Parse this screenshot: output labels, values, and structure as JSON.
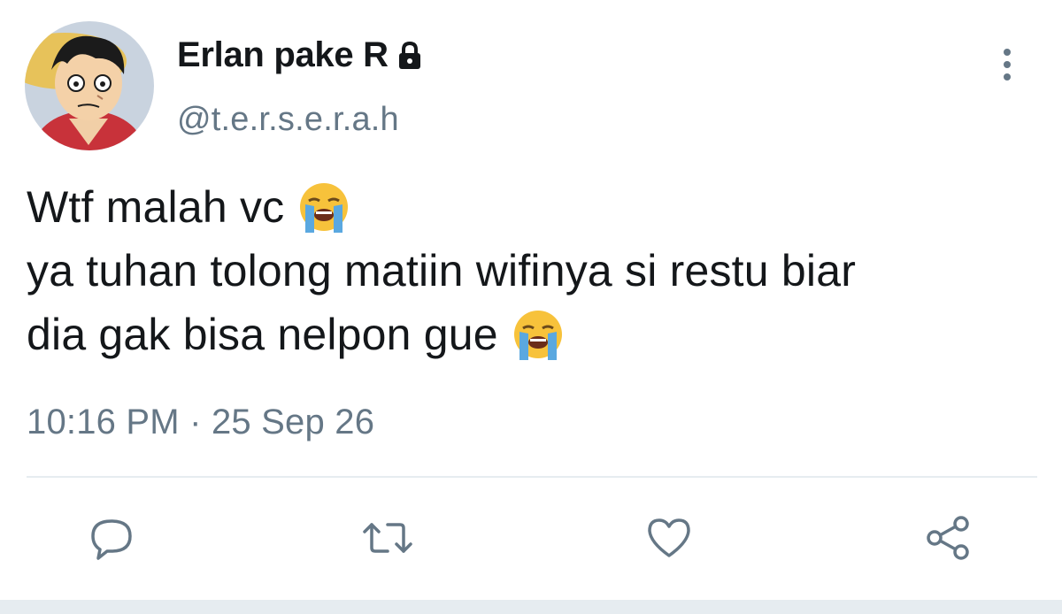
{
  "author": {
    "display_name": "Erlan pake R",
    "handle": "@t.e.r.s.e.r.a.h",
    "protected_icon": "lock-icon",
    "avatar_icon": "avatar-image"
  },
  "tweet": {
    "lines": [
      "Wtf malah vc",
      "ya tuhan tolong matiin wifinya si restu biar",
      "dia gak bisa nelpon gue"
    ],
    "emoji": "loudly-crying-face-icon",
    "timestamp": "10:16 PM · 25 Sep 26"
  },
  "actions": {
    "reply": "reply-icon",
    "retweet": "retweet-icon",
    "like": "heart-icon",
    "share": "share-icon",
    "more": "more-vertical-icon"
  },
  "colors": {
    "text": "#14171a",
    "secondary": "#657786",
    "divider": "#e6ecf0",
    "emoji_face": "#f7c23b",
    "tears": "#5aa8e0"
  }
}
